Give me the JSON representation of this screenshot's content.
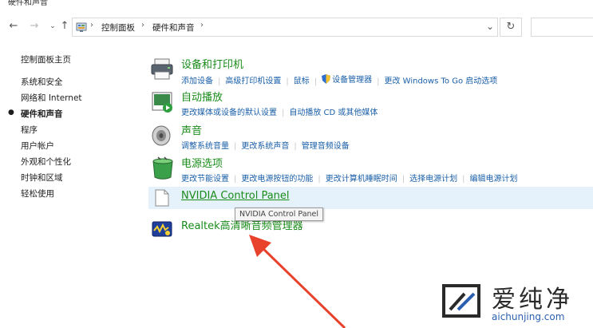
{
  "window": {
    "title": "硬件和声音"
  },
  "address": {
    "crumbs": [
      "控制面板",
      "硬件和声音"
    ]
  },
  "sidebar": {
    "items": [
      {
        "label": "控制面板主页",
        "active": false
      },
      {
        "label": "系统和安全",
        "active": false
      },
      {
        "label": "网络和 Internet",
        "active": false
      },
      {
        "label": "硬件和声音",
        "active": true
      },
      {
        "label": "程序",
        "active": false
      },
      {
        "label": "用户帐户",
        "active": false
      },
      {
        "label": "外观和个性化",
        "active": false
      },
      {
        "label": "时钟和区域",
        "active": false
      },
      {
        "label": "轻松使用",
        "active": false
      }
    ]
  },
  "categories": {
    "devices": {
      "title": "设备和打印机",
      "links": [
        "添加设备",
        "高级打印机设置",
        "鼠标",
        "设备管理器",
        "更改 Windows To Go 启动选项"
      ]
    },
    "autoplay": {
      "title": "自动播放",
      "links": [
        "更改媒体或设备的默认设置",
        "自动播放 CD 或其他媒体"
      ]
    },
    "sound": {
      "title": "声音",
      "links": [
        "调整系统音量",
        "更改系统声音",
        "管理音频设备"
      ]
    },
    "power": {
      "title": "电源选项",
      "links": [
        "更改节能设置",
        "更改电源按钮的功能",
        "更改计算机睡眠时间",
        "选择电源计划",
        "编辑电源计划"
      ]
    },
    "nvidia": {
      "title": "NVIDIA Control Panel",
      "tooltip": "NVIDIA Control Panel"
    },
    "realtek": {
      "title": "Realtek高清晰音频管理器"
    }
  },
  "watermark": {
    "text": "爱纯净",
    "url": "aichunjing.com"
  },
  "colors": {
    "heading": "#1a8c1a",
    "link": "#1a5fa8",
    "hover": "#e5f1fb",
    "arrow": "#e8412c"
  },
  "icons": [
    "back-arrow-icon",
    "forward-arrow-icon",
    "recent-dropdown-icon",
    "up-arrow-icon",
    "control-panel-icon",
    "refresh-icon",
    "printer-icon",
    "autoplay-icon",
    "speaker-icon",
    "battery-icon",
    "shield-icon",
    "document-icon",
    "realtek-icon"
  ]
}
